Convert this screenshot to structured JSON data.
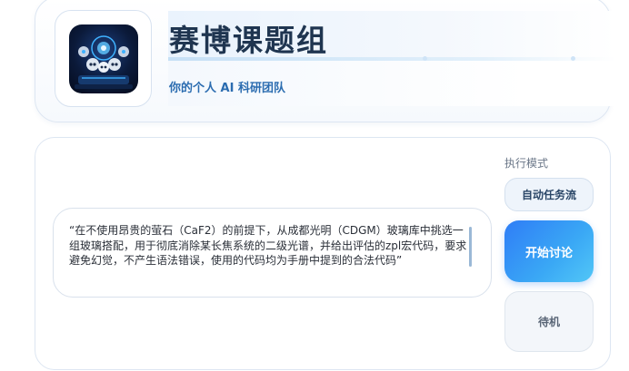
{
  "header": {
    "title": "赛博课题组",
    "subtitle": "你的个人 AI 科研团队",
    "logo_icon": "robot-team-logo-icon"
  },
  "prompt": {
    "text": "“在不使用昂贵的萤石（CaF2）的前提下，从成都光明（CDGM）玻璃库中挑选一组玻璃搭配，用于彻底消除某长焦系统的二级光谱，并给出评估的zpl宏代码，要求避免幻觉，不产生语法错误，使用的代码均为手册中提到的合法代码”"
  },
  "execution": {
    "mode_label": "执行模式",
    "auto_button": "自动任务流",
    "start_button": "开始讨论",
    "standby_button": "待机"
  },
  "colors": {
    "accent": "#2f7df6",
    "title": "#1f3550",
    "subtitle": "#2b6cb0"
  }
}
